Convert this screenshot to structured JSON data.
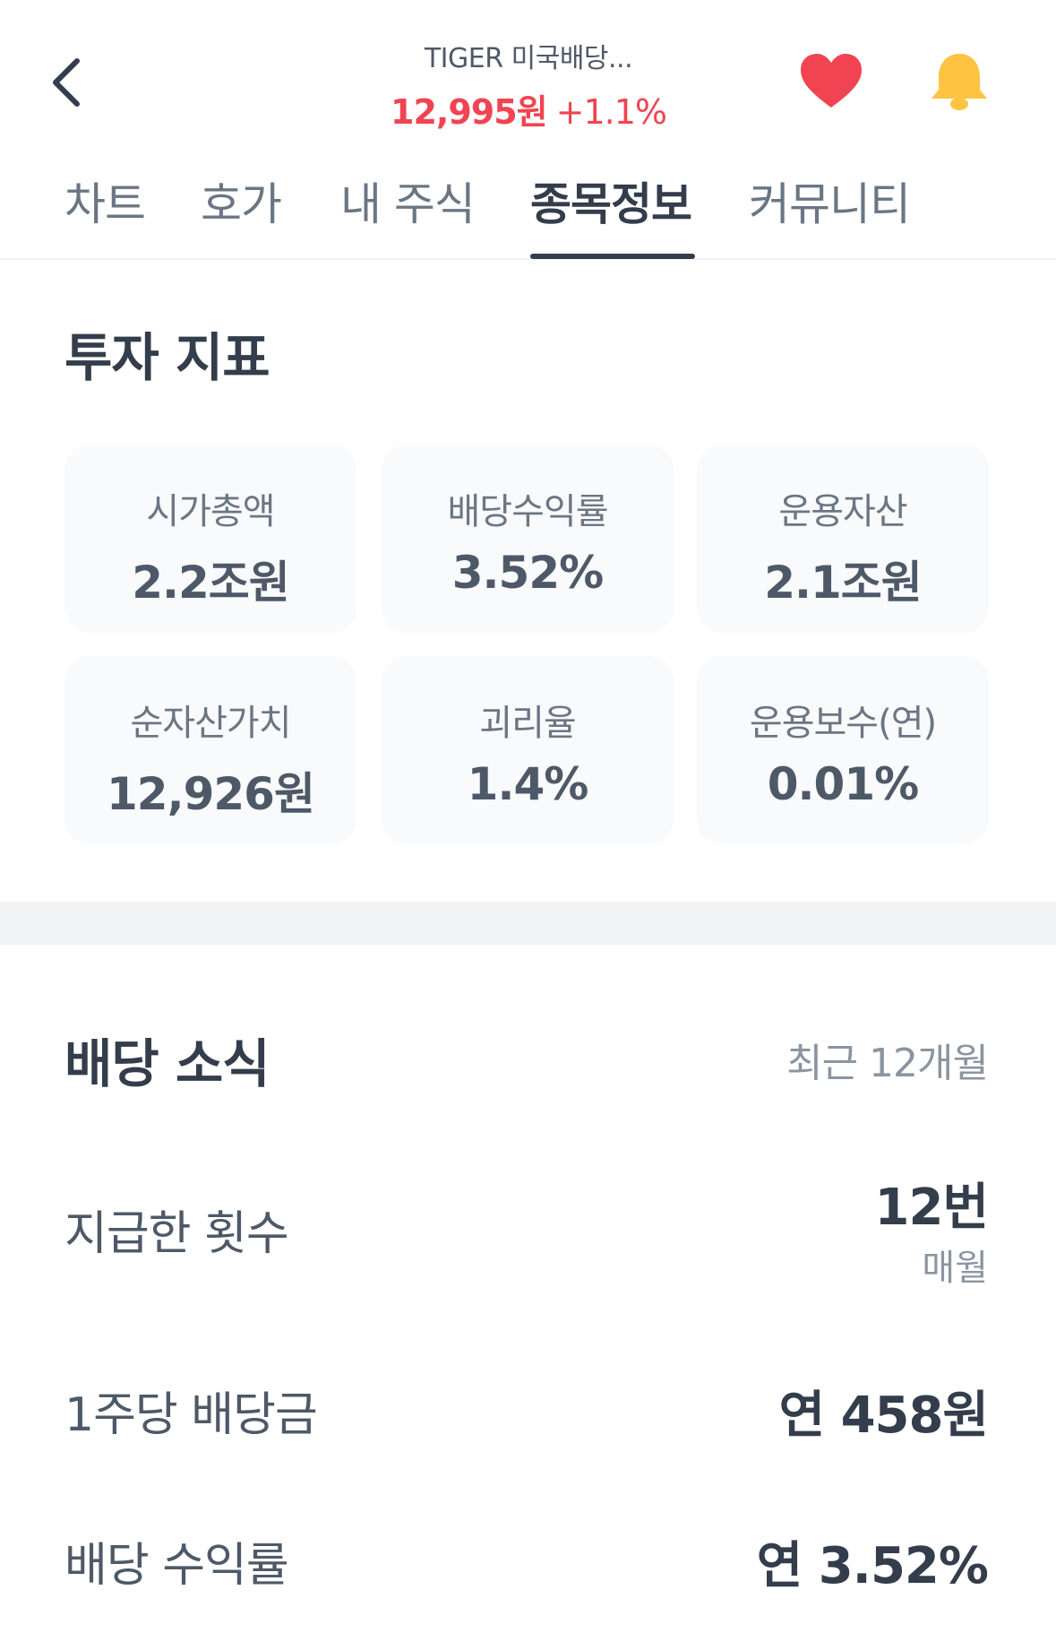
{
  "header": {
    "stock_name": "TIGER 미국배당...",
    "price": "12,995원",
    "change": "+1.1%",
    "accent_up_color": "#f04452",
    "heart_color": "#f04452",
    "bell_color": "#ffc342"
  },
  "tabs": [
    {
      "label": "차트"
    },
    {
      "label": "호가"
    },
    {
      "label": "내 주식"
    },
    {
      "label": "종목정보",
      "active": true
    },
    {
      "label": "커뮤니티"
    }
  ],
  "indicators": {
    "title": "투자 지표",
    "items": [
      {
        "label": "시가총액",
        "value": "2.2조원"
      },
      {
        "label": "배당수익률",
        "value": "3.52%"
      },
      {
        "label": "운용자산",
        "value": "2.1조원"
      },
      {
        "label": "순자산가치",
        "value": "12,926원"
      },
      {
        "label": "괴리율",
        "value": "1.4%"
      },
      {
        "label": "운용보수(연)",
        "value": "0.01%"
      }
    ]
  },
  "dividend": {
    "title": "배당 소식",
    "period": "최근 12개월",
    "rows": [
      {
        "label": "지급한 횟수",
        "value": "12번",
        "sub": "매월"
      },
      {
        "label": "1주당 배당금",
        "value": "연 458원"
      },
      {
        "label": "배당 수익률",
        "value": "연 3.52%"
      }
    ]
  }
}
